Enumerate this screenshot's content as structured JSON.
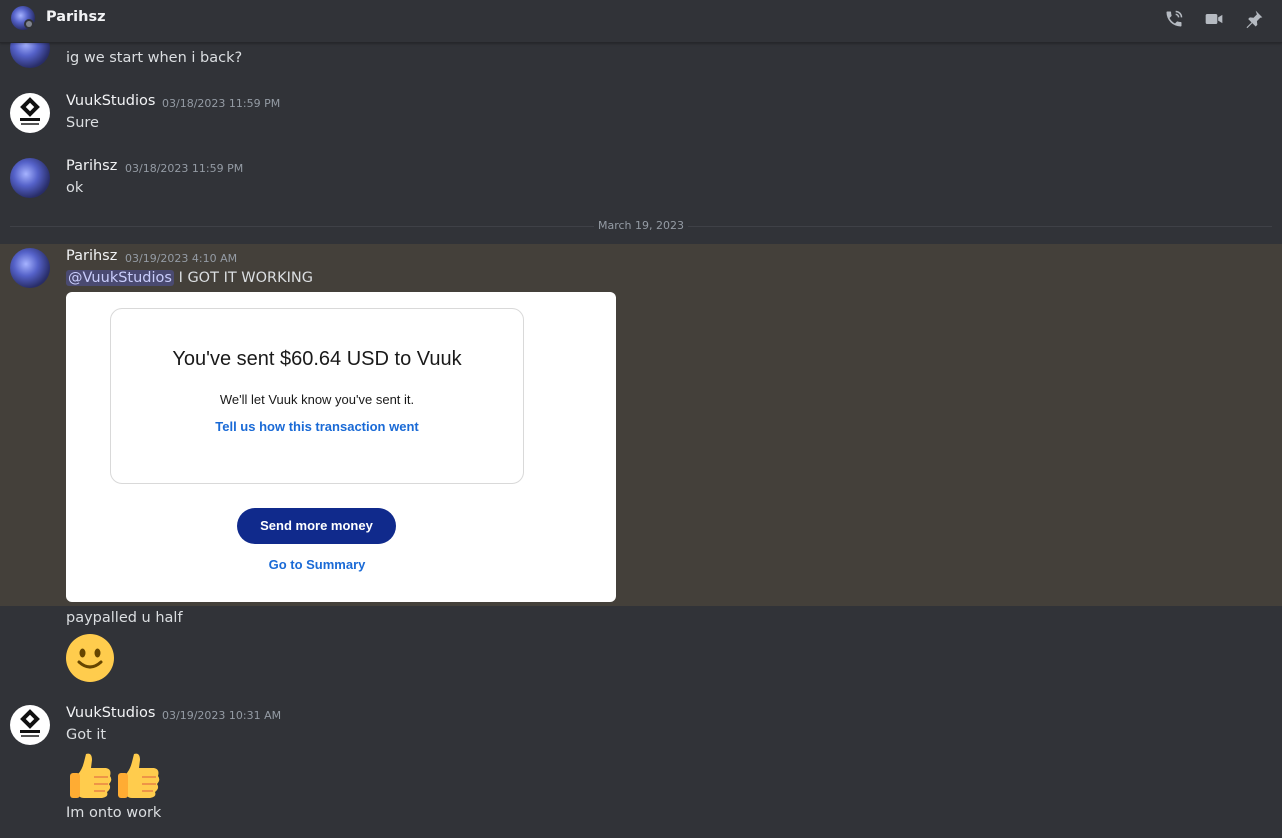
{
  "header": {
    "title": "Parihsz",
    "icons": [
      "voice-call-icon",
      "video-call-icon",
      "pin-icon"
    ]
  },
  "messages": {
    "m0": {
      "text": "ig we start when i back?"
    },
    "m1": {
      "author": "VuukStudios",
      "timestamp": "03/18/2023 11:59 PM",
      "text": "Sure"
    },
    "m2": {
      "author": "Parihsz",
      "timestamp": "03/18/2023 11:59 PM",
      "text": "ok"
    },
    "divider": "March 19, 2023",
    "m3": {
      "author": "Parihsz",
      "timestamp": "03/19/2023 4:10 AM",
      "mention": "@VuukStudios",
      "text": "I GOT IT WORKING",
      "attachment": {
        "headline": "You've sent $60.64 USD to Vuuk",
        "subtext": "We'll let Vuuk know you've sent it.",
        "feedback_link": "Tell us how this transaction went",
        "primary_button": "Send more money",
        "summary_link": "Go to Summary"
      },
      "followup": "paypalled u half",
      "emoji": "slightly-smiling-face"
    },
    "m4": {
      "author": "VuukStudios",
      "timestamp": "03/19/2023 10:31 AM",
      "text": "Got it",
      "emoji": "thumbs-up x2",
      "followup": "Im onto work"
    }
  },
  "colors": {
    "background": "#313338",
    "highlight": "#44403a",
    "mention": "#5865f2",
    "paypal_blue": "#102a8c",
    "link_blue": "#1a6ad6"
  }
}
